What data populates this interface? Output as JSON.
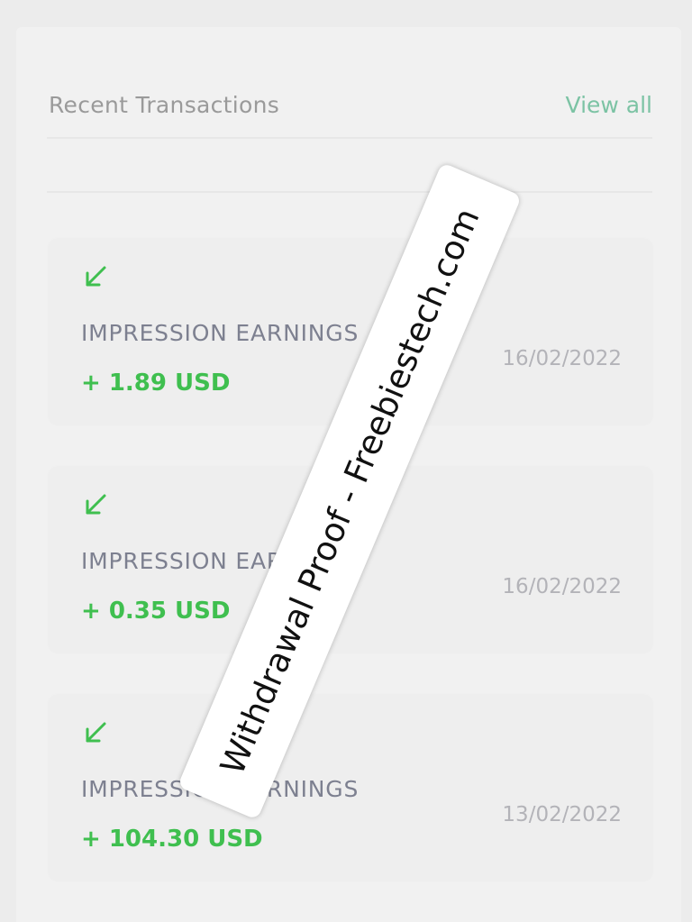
{
  "header": {
    "title": "Recent Transactions",
    "view_all": "View all"
  },
  "transactions": [
    {
      "type": "IMPRESSION EARNINGS",
      "amount": "+ 1.89 USD",
      "date": "16/02/2022",
      "icon": "arrow-down-left-icon"
    },
    {
      "type": "IMPRESSION EARNINGS",
      "amount": "+ 0.35 USD",
      "date": "16/02/2022",
      "icon": "arrow-down-left-icon"
    },
    {
      "type": "IMPRESSION EARNINGS",
      "amount": "+ 104.30 USD",
      "date": "13/02/2022",
      "icon": "arrow-down-left-icon"
    }
  ],
  "watermark": {
    "text": "Withdrawal Proof - Freebiestech.com"
  },
  "colors": {
    "accent_green": "#3fbf4f",
    "view_all": "#7cc3a4",
    "label_gray": "#7d8090"
  }
}
